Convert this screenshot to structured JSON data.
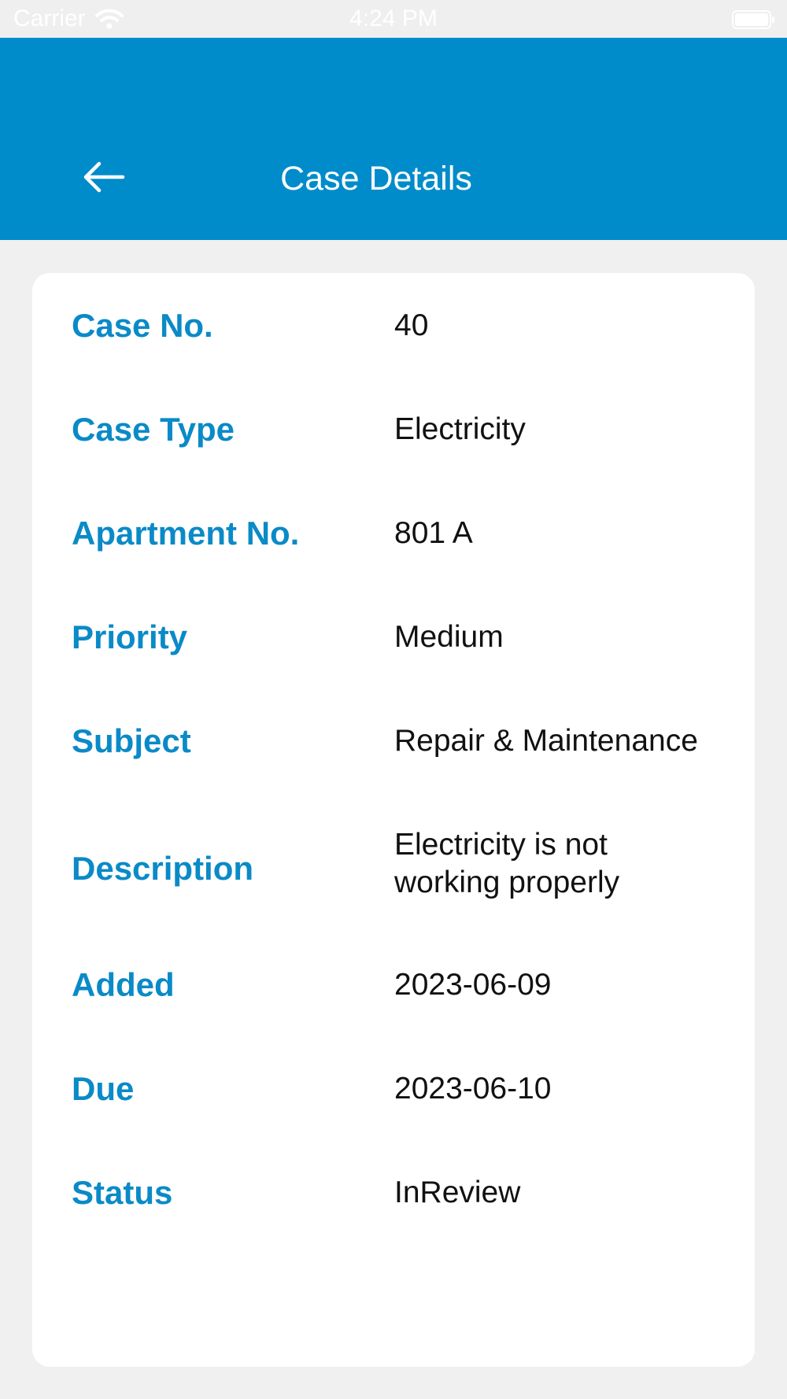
{
  "status_bar": {
    "carrier": "Carrier",
    "time": "4:24 PM",
    "wifi_icon": "wifi-icon",
    "battery_icon": "battery-icon"
  },
  "header": {
    "title": "Case Details",
    "back_icon": "arrow-left-icon",
    "color": "#008ccb"
  },
  "details": {
    "case_no": {
      "label": "Case No.",
      "value": "40"
    },
    "case_type": {
      "label": "Case Type",
      "value": "Electricity"
    },
    "apartment_no": {
      "label": "Apartment No.",
      "value": "801 A"
    },
    "priority": {
      "label": "Priority",
      "value": "Medium"
    },
    "subject": {
      "label": "Subject",
      "value": "Repair & Maintenance"
    },
    "description": {
      "label": "Description",
      "value_line1": "Electricity is not",
      "value_line2": "working properly"
    },
    "added": {
      "label": "Added",
      "value": "2023-06-09"
    },
    "due": {
      "label": "Due",
      "value": "2023-06-10"
    },
    "status": {
      "label": "Status",
      "value": "InReview"
    }
  }
}
